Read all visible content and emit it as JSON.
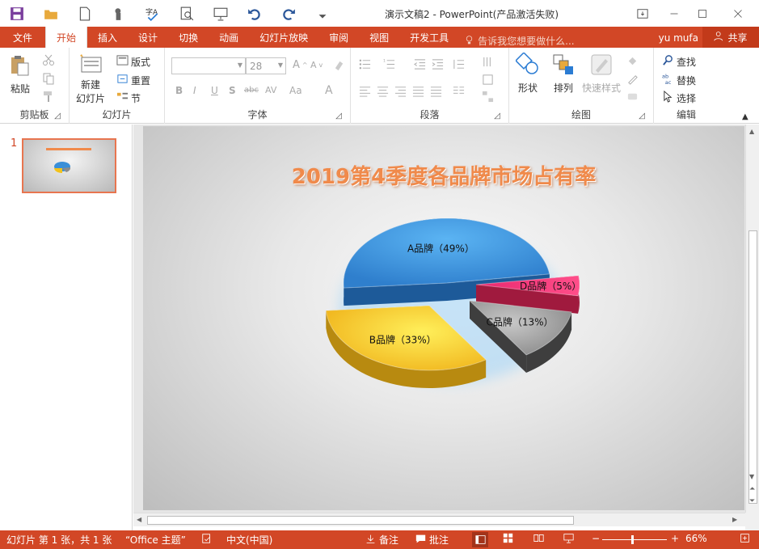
{
  "app": {
    "title": "演示文稿2 - PowerPoint(产品激活失败)"
  },
  "qat": {
    "icons": [
      "save-icon",
      "open-folder-icon",
      "new-file-icon",
      "touch-mode-icon",
      "spelling-icon",
      "print-preview-icon",
      "slideshow-icon",
      "undo-icon",
      "redo-icon",
      "customize-icon"
    ]
  },
  "tabs": {
    "file": "文件",
    "items": [
      "开始",
      "插入",
      "设计",
      "切换",
      "动画",
      "幻灯片放映",
      "审阅",
      "视图",
      "开发工具"
    ],
    "active": "开始",
    "tell_me_placeholder": "告诉我您想要做什么...",
    "user": "yu mufa",
    "share": "共享"
  },
  "ribbon": {
    "clipboard": {
      "label": "剪贴板",
      "paste": "粘贴"
    },
    "slides": {
      "label": "幻灯片",
      "new_slide_line1": "新建",
      "new_slide_line2": "幻灯片",
      "layout": "版式",
      "reset": "重置",
      "section": "节"
    },
    "font": {
      "label": "字体",
      "font_name": "",
      "font_size": "28"
    },
    "paragraph": {
      "label": "段落"
    },
    "drawing": {
      "label": "绘图",
      "shapes": "形状",
      "arrange": "排列",
      "quick_styles": "快速样式"
    },
    "editing": {
      "label": "编辑",
      "find": "查找",
      "replace": "替换",
      "select": "选择"
    }
  },
  "thumbnails": {
    "slide_number": "1"
  },
  "slide": {
    "title": "2019第4季度各品牌市场占有率"
  },
  "chart_data": {
    "type": "pie",
    "title": "2019第4季度各品牌市场占有率",
    "categories": [
      "A品牌",
      "B品牌",
      "C品牌",
      "D品牌"
    ],
    "values": [
      49,
      33,
      13,
      5
    ],
    "labels": [
      "A品牌（49%）",
      "B品牌（33%）",
      "C品牌（13%）",
      "D品牌（5%）"
    ],
    "colors": [
      "#3a8fd8",
      "#f3c21a",
      "#8c8c8c",
      "#e0306e"
    ],
    "style": "3d-exploded"
  },
  "status": {
    "slide_info": "幻灯片 第 1 张，共 1 张",
    "theme": "“Office 主题”",
    "language": "中文(中国)",
    "notes": "备注",
    "comments": "批注",
    "zoom": "66%"
  }
}
